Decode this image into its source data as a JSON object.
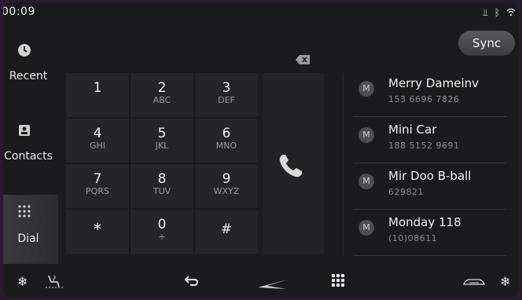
{
  "status": {
    "time": "00:09",
    "icons": [
      "usb-icon",
      "bluetooth-icon",
      "wifi-icon"
    ]
  },
  "sidebar": {
    "items": [
      {
        "label": "Recent",
        "icon": "clock-icon",
        "active": false
      },
      {
        "label": "Contacts",
        "icon": "contact-card-icon",
        "active": false
      },
      {
        "label": "Dial",
        "icon": "keypad-icon",
        "active": true
      }
    ]
  },
  "sync_label": "Sync",
  "keypad": {
    "keys": [
      {
        "digit": "1",
        "letters": ""
      },
      {
        "digit": "2",
        "letters": "ABC"
      },
      {
        "digit": "3",
        "letters": "DEF"
      },
      {
        "digit": "4",
        "letters": "GHI"
      },
      {
        "digit": "5",
        "letters": "JKL"
      },
      {
        "digit": "6",
        "letters": "MNO"
      },
      {
        "digit": "7",
        "letters": "PQRS"
      },
      {
        "digit": "8",
        "letters": "TUV"
      },
      {
        "digit": "9",
        "letters": "WXYZ"
      },
      {
        "digit": "*",
        "letters": ""
      },
      {
        "digit": "0",
        "letters": "+"
      },
      {
        "digit": "#",
        "letters": ""
      }
    ]
  },
  "contacts": [
    {
      "badge": "M",
      "name": "Merry Dameinv",
      "number": "153 6696 7826"
    },
    {
      "badge": "M",
      "name": "Mini Car",
      "number": "188 5152 9691"
    },
    {
      "badge": "M",
      "name": "Mir Doo B-ball",
      "number": "629821"
    },
    {
      "badge": "M",
      "name": "Monday 118",
      "number": "(10)08611"
    }
  ],
  "bottom_bar": [
    "fan-icon",
    "seat-climate-icon",
    "back-icon",
    "home-logo-icon",
    "apps-grid-icon",
    "car-air-icon",
    "fan-icon"
  ],
  "colors": {
    "background": "#1b1b1d",
    "key": "#252528",
    "call_icon": "#d9d9d9"
  }
}
